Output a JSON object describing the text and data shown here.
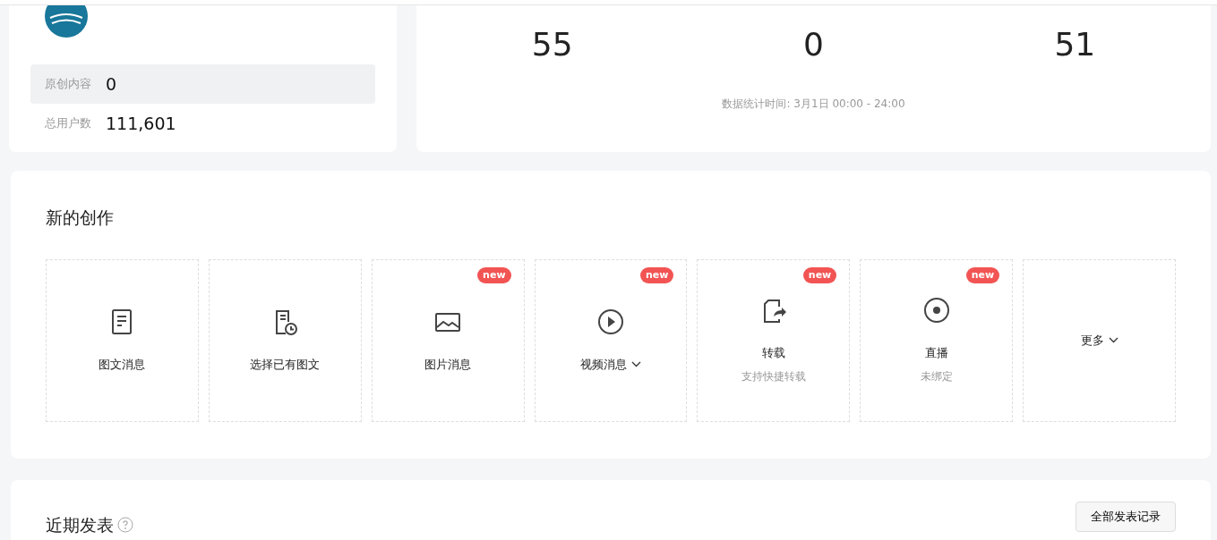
{
  "account": {
    "stats": [
      {
        "label": "原创内容",
        "value": "0",
        "highlighted": true
      },
      {
        "label": "总用户数",
        "value": "111,601",
        "highlighted": false
      }
    ]
  },
  "yesterday": {
    "metrics": [
      {
        "value": "55"
      },
      {
        "value": "0"
      },
      {
        "value": "51"
      }
    ],
    "note": "数据统计时间: 3月1日 00:00 - 24:00"
  },
  "create": {
    "title": "新的创作",
    "tiles": [
      {
        "kind": "article",
        "label": "图文消息",
        "dropdown": false
      },
      {
        "kind": "pick",
        "label": "选择已有图文",
        "dropdown": false
      },
      {
        "kind": "image",
        "label": "图片消息",
        "badge": "new",
        "dropdown": false
      },
      {
        "kind": "video",
        "label": "视频消息",
        "badge": "new",
        "dropdown": true
      },
      {
        "kind": "repost",
        "label": "转载",
        "sub": "支持快捷转载",
        "badge": "new",
        "dropdown": false
      },
      {
        "kind": "live",
        "label": "直播",
        "sub": "未绑定",
        "badge": "new",
        "dropdown": false
      },
      {
        "kind": "more",
        "label": "更多",
        "dropdown": true
      }
    ]
  },
  "recent": {
    "title": "近期发表",
    "button": "全部发表记录"
  }
}
